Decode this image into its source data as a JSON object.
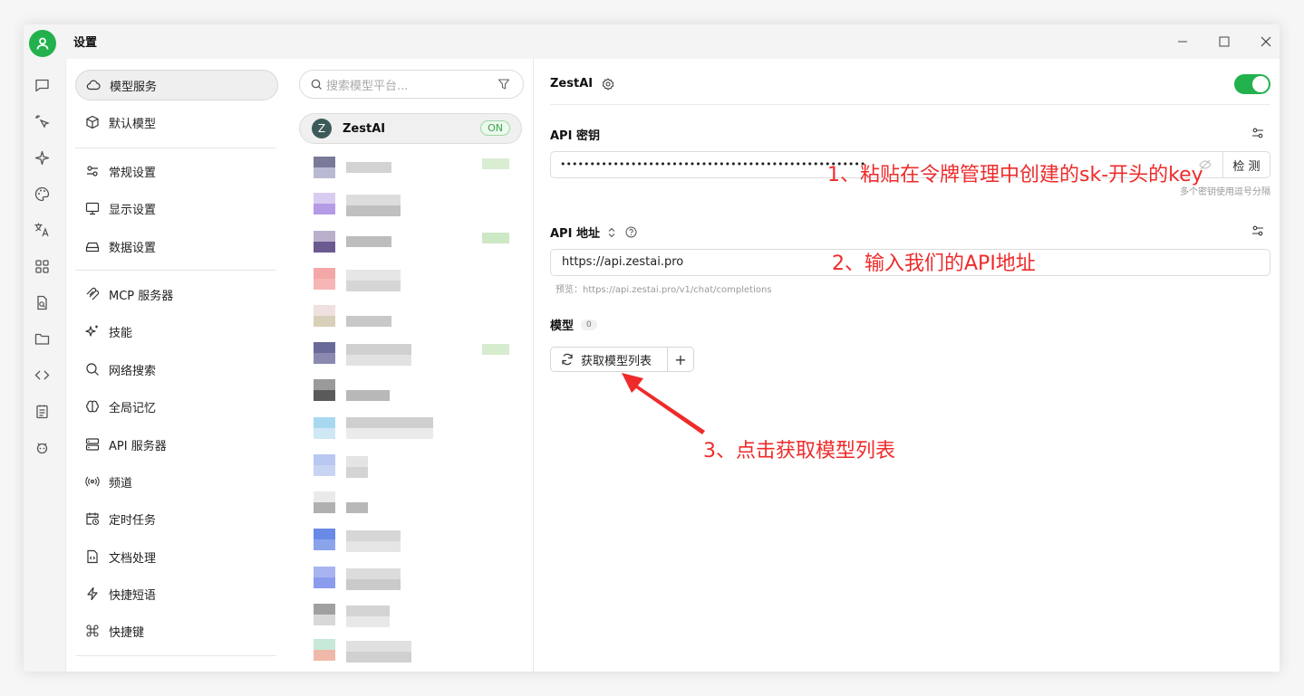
{
  "window": {
    "title": "设置",
    "accent": "#22b14c",
    "controls": [
      "minimize-icon",
      "maximize-icon",
      "close-icon"
    ]
  },
  "rail": {
    "icons": [
      "chat-icon",
      "cursor-sparkle-icon",
      "sparkle-icon",
      "palette-icon",
      "translate-icon",
      "apps-grid-icon",
      "file-search-icon",
      "folder-icon",
      "code-icon",
      "notes-icon",
      "robot-icon"
    ]
  },
  "menu": {
    "items": [
      {
        "label": "模型服务",
        "icon": "cloud-icon"
      },
      {
        "label": "默认模型",
        "icon": "cube-icon"
      },
      {
        "label": "常规设置",
        "icon": "settings-sliders-icon"
      },
      {
        "label": "显示设置",
        "icon": "monitor-icon"
      },
      {
        "label": "数据设置",
        "icon": "storage-icon"
      },
      {
        "label": "MCP 服务器",
        "icon": "mcp-icon"
      },
      {
        "label": "技能",
        "icon": "sparkles-icon"
      },
      {
        "label": "网络搜索",
        "icon": "search-icon"
      },
      {
        "label": "全局记忆",
        "icon": "brain-icon"
      },
      {
        "label": "API 服务器",
        "icon": "server-icon"
      },
      {
        "label": "频道",
        "icon": "broadcast-icon"
      },
      {
        "label": "定时任务",
        "icon": "calendar-clock-icon"
      },
      {
        "label": "文档处理",
        "icon": "document-code-icon"
      },
      {
        "label": "快捷短语",
        "icon": "lightning-icon"
      },
      {
        "label": "快捷键",
        "icon": "command-icon"
      }
    ]
  },
  "providers": {
    "search_placeholder": "搜索模型平台...",
    "active": {
      "initial": "Z",
      "name": "ZestAI",
      "badge": "ON"
    }
  },
  "detail": {
    "provider_name": "ZestAI",
    "enabled": true,
    "api_key": {
      "label": "API 密钥",
      "value": "••••••••••••••••••••••••••••••••••••••••••••••••••••",
      "check_button": "检 测",
      "hint": "多个密钥使用逗号分隔"
    },
    "api_url": {
      "label": "API 地址",
      "value": "https://api.zestai.pro",
      "preview": "预览：https://api.zestai.pro/v1/chat/completions"
    },
    "models": {
      "label": "模型",
      "count": "0",
      "fetch_button": "获取模型列表",
      "add_button": "+"
    }
  },
  "annotations": {
    "step1": "1、粘贴在令牌管理中创建的sk-开头的key",
    "step2": "2、输入我们的API地址",
    "step3": "3、点击获取模型列表",
    "color": "#ee2b2b"
  }
}
